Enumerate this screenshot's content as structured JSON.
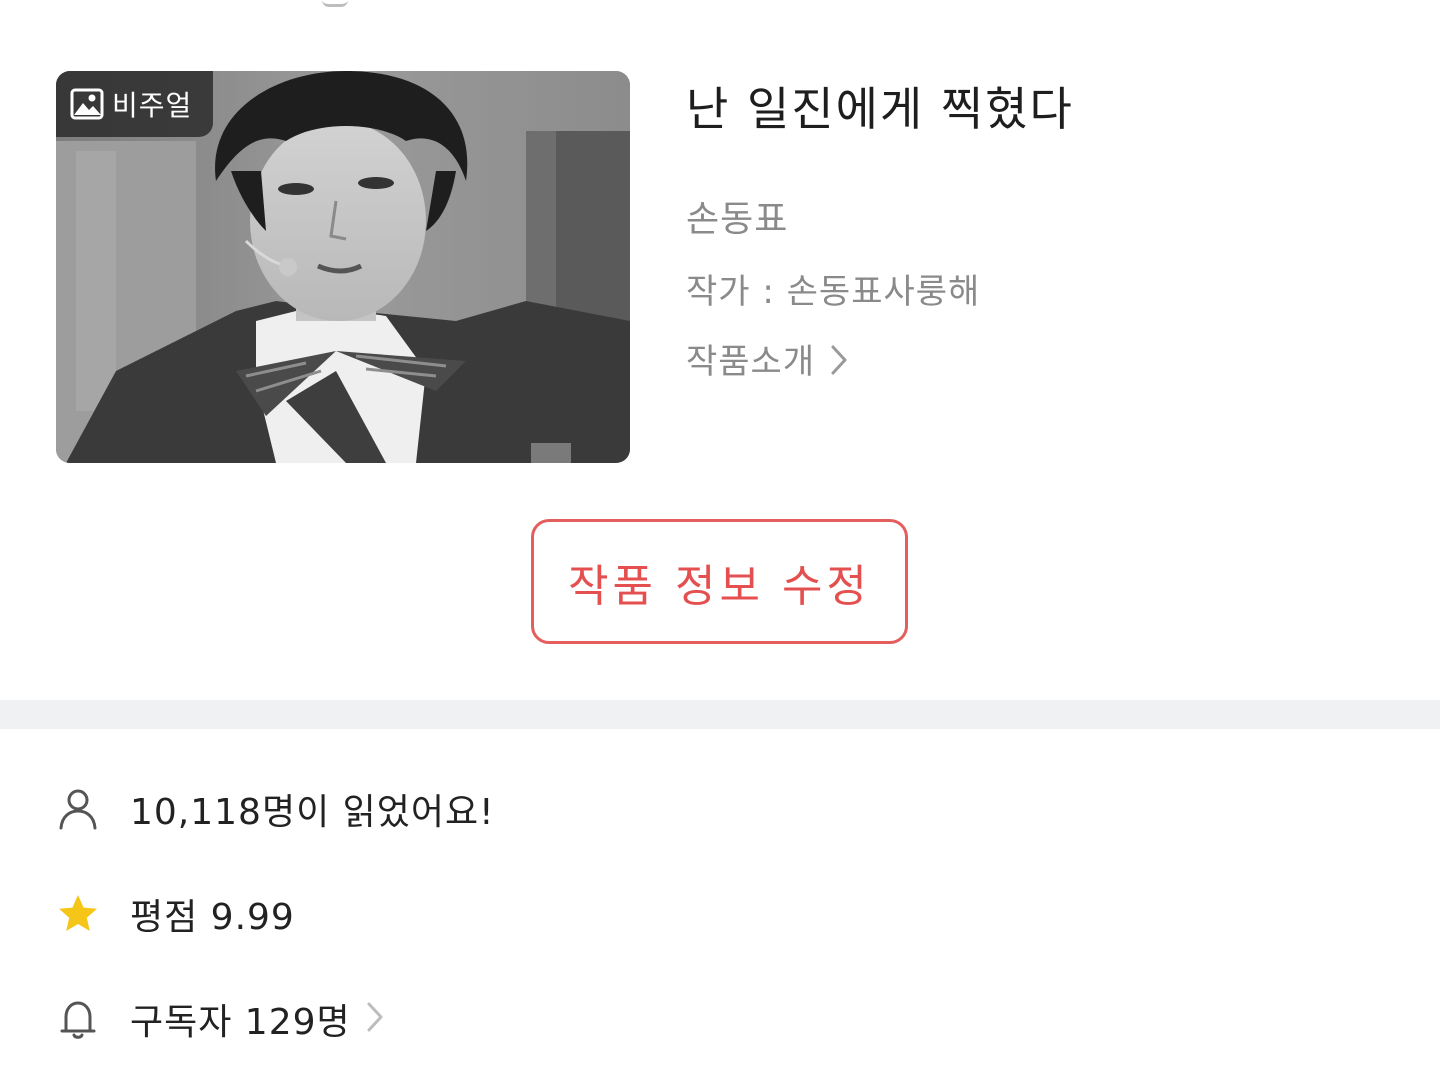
{
  "work": {
    "visual_badge_label": "비주얼",
    "title": "난 일진에게 찍혔다",
    "subtitle": "손동표",
    "author": "작가 : 손동표사룽해",
    "intro_label": "작품소개"
  },
  "actions": {
    "edit_label": "작품 정보 수정"
  },
  "stats": {
    "readers": "10,118명이 읽었어요!",
    "rating": "평점 9.99",
    "subscribers": "구독자 129명"
  },
  "colors": {
    "accent": "#e45050",
    "star": "#f5c518",
    "muted": "#8a8a8a",
    "divider": "#eff1f3"
  },
  "icons": {
    "badge": "image-icon",
    "intro": "chevron-right-icon",
    "readers": "person-icon",
    "rating": "star-icon",
    "subscribers": "bell-icon"
  }
}
